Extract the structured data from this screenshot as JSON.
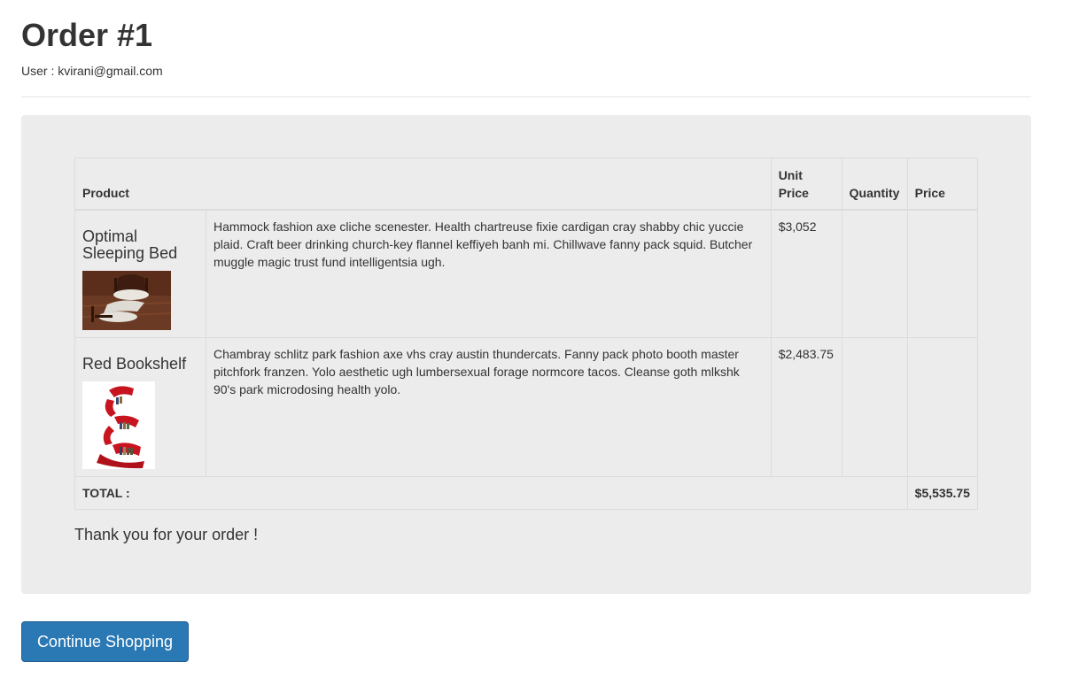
{
  "order": {
    "title": "Order #1",
    "user_line": "User : kvirani@gmail.com"
  },
  "table": {
    "headers": {
      "product": "Product",
      "unit_price": "Unit Price",
      "quantity": "Quantity",
      "price": "Price"
    },
    "items": [
      {
        "name": "Optimal Sleeping Bed",
        "description": "Hammock fashion axe cliche scenester. Health chartreuse fixie cardigan cray shabby chic yuccie plaid. Craft beer drinking church-key flannel keffiyeh banh mi. Chillwave fanny pack squid. Butcher muggle magic trust fund intelligentsia ugh.",
        "unit_price": "$3,052",
        "quantity": "",
        "price": ""
      },
      {
        "name": "Red Bookshelf",
        "description": "Chambray schlitz park fashion axe vhs cray austin thundercats. Fanny pack photo booth master pitchfork franzen. Yolo aesthetic ugh lumbersexual forage normcore tacos. Cleanse goth mlkshk 90's park microdosing health yolo.",
        "unit_price": "$2,483.75",
        "quantity": "",
        "price": ""
      }
    ],
    "total_label": "TOTAL :",
    "total_value": "$5,535.75"
  },
  "thanks": "Thank you for your order !",
  "continue_button": "Continue Shopping",
  "colors": {
    "well_bg": "#ececec",
    "button_bg": "#2a78b4",
    "text": "#333333"
  }
}
